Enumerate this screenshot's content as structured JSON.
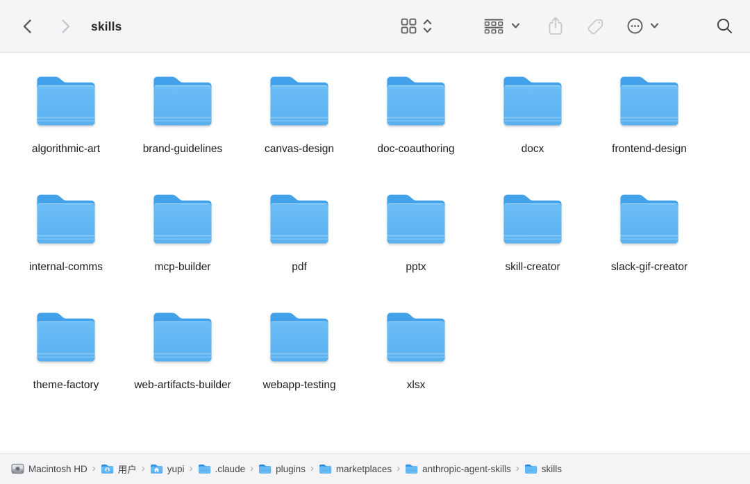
{
  "window": {
    "title": "skills"
  },
  "toolbar": {
    "icons": [
      "chevron-left-back",
      "chevron-right-forward",
      "view-grid",
      "view-up-down-chevrons",
      "group-by",
      "chevron-down",
      "share",
      "tag",
      "more-options-ellipsis",
      "chevron-down",
      "search"
    ],
    "disabled_icons": [
      "chevron-right-forward",
      "share",
      "tag"
    ]
  },
  "colors": {
    "toolbar_bg": "#F5F4F6",
    "pathbar_bg": "#F4F3F5",
    "content_bg": "#FFFFFF",
    "folder_back": "#2F93E3",
    "folder_front_top": "#6CBEF6",
    "folder_front_bottom": "#59B0EF",
    "icon_enabled": "#5E5E61",
    "icon_disabled": "#C7C6C9",
    "label_text": "#1D1D1F"
  },
  "folders": [
    "algorithmic-art",
    "brand-guidelines",
    "canvas-design",
    "doc-coauthoring",
    "docx",
    "frontend-design",
    "internal-comms",
    "mcp-builder",
    "pdf",
    "pptx",
    "skill-creator",
    "slack-gif-creator",
    "theme-factory",
    "web-artifacts-builder",
    "webapp-testing",
    "xlsx"
  ],
  "pathbar": {
    "separator": "›",
    "items": [
      {
        "icon": "drive",
        "label": "Macintosh HD"
      },
      {
        "icon": "folder-user",
        "label": "用户"
      },
      {
        "icon": "folder-home",
        "label": "yupi"
      },
      {
        "icon": "folder",
        "label": ".claude"
      },
      {
        "icon": "folder",
        "label": "plugins"
      },
      {
        "icon": "folder",
        "label": "marketplaces"
      },
      {
        "icon": "folder",
        "label": "anthropic-agent-skills"
      },
      {
        "icon": "folder",
        "label": "skills"
      }
    ]
  }
}
